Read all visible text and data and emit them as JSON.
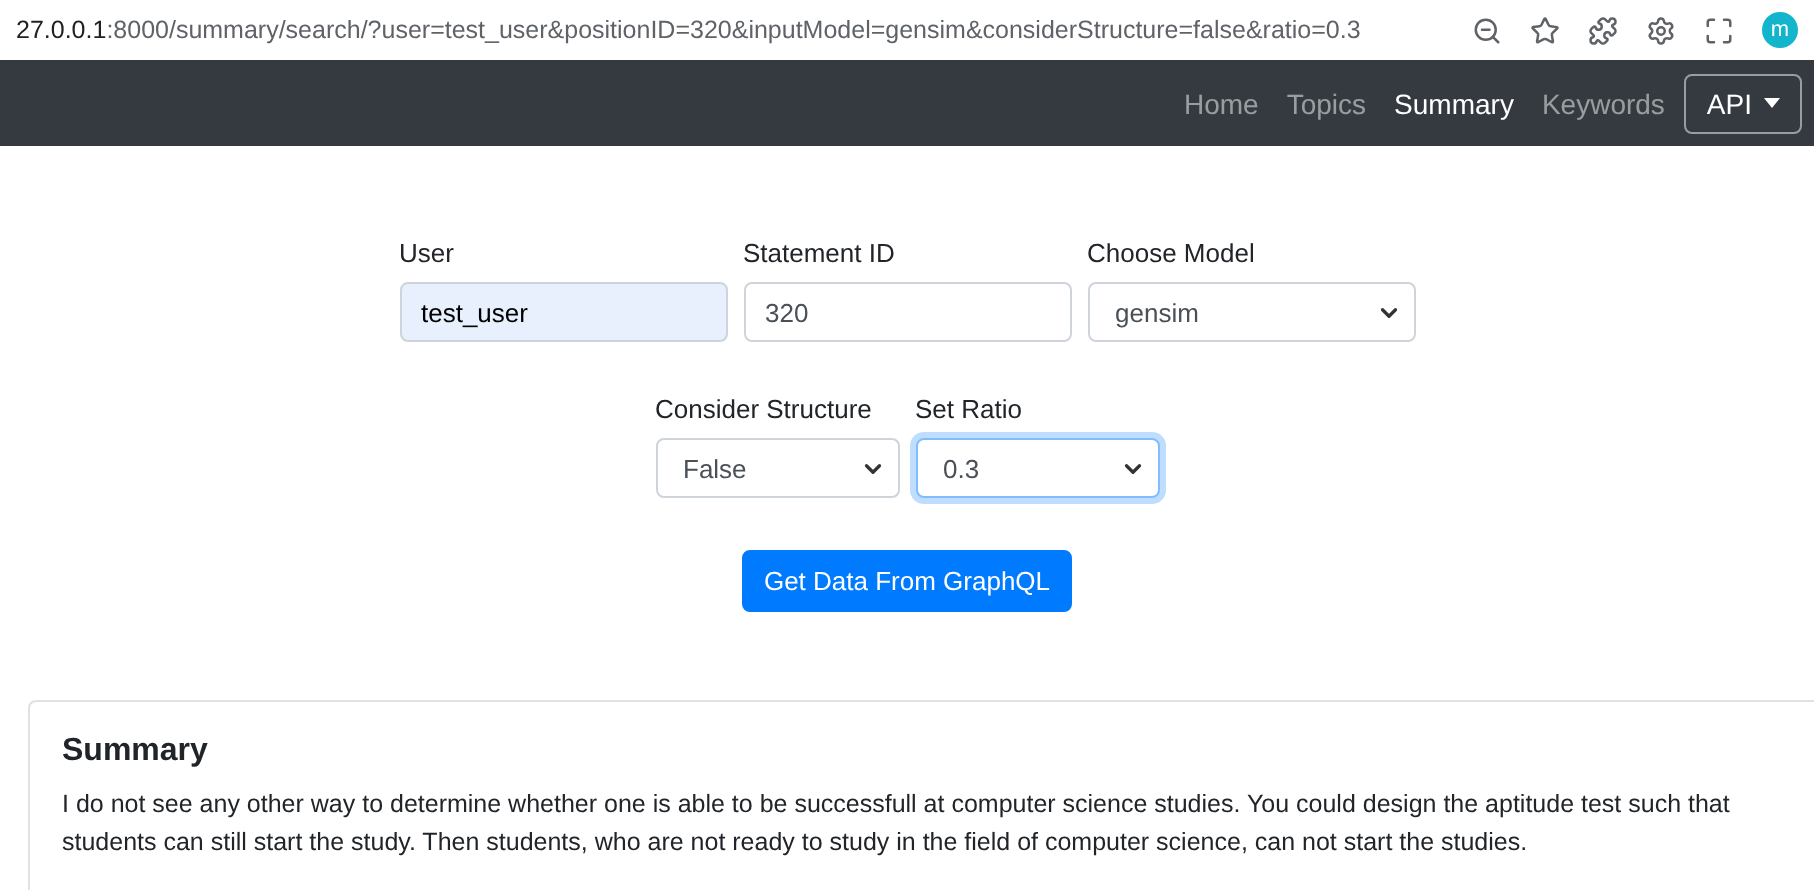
{
  "address_bar": {
    "host": "27.0.0.1",
    "path": ":8000/summary/search/?user=test_user&positionID=320&inputModel=gensim&considerStructure=false&ratio=0.3",
    "profile_initial": "m"
  },
  "navbar": {
    "items": [
      {
        "label": "Home",
        "selected": false
      },
      {
        "label": "Topics",
        "selected": false
      },
      {
        "label": "Summary",
        "selected": true
      },
      {
        "label": "Keywords",
        "selected": false
      }
    ],
    "dropdown": {
      "label": "API"
    }
  },
  "form": {
    "main_fields": [
      {
        "kind": "input",
        "label": "User",
        "value": "test_user",
        "autofilled": true,
        "focused": false
      },
      {
        "kind": "input",
        "label": "Statement ID",
        "value": "320",
        "autofilled": false,
        "focused": false
      },
      {
        "kind": "select",
        "label": "Choose Model",
        "value": "gensim",
        "autofilled": false,
        "focused": false
      }
    ],
    "option_fields": [
      {
        "kind": "select",
        "label": "Consider Structure",
        "value": "False",
        "autofilled": false,
        "focused": false
      },
      {
        "kind": "select",
        "label": "Set Ratio",
        "value": "0.3",
        "autofilled": false,
        "focused": true
      }
    ],
    "submit": "Get Data From GraphQL"
  },
  "summary": {
    "title": "Summary",
    "text": "I do not see any other way to determine whether one is able to be successfull at computer science studies. You could design the aptitude test such that students can still start the study. Then students, who are not ready to study in the field of computer science, can not start the studies."
  }
}
